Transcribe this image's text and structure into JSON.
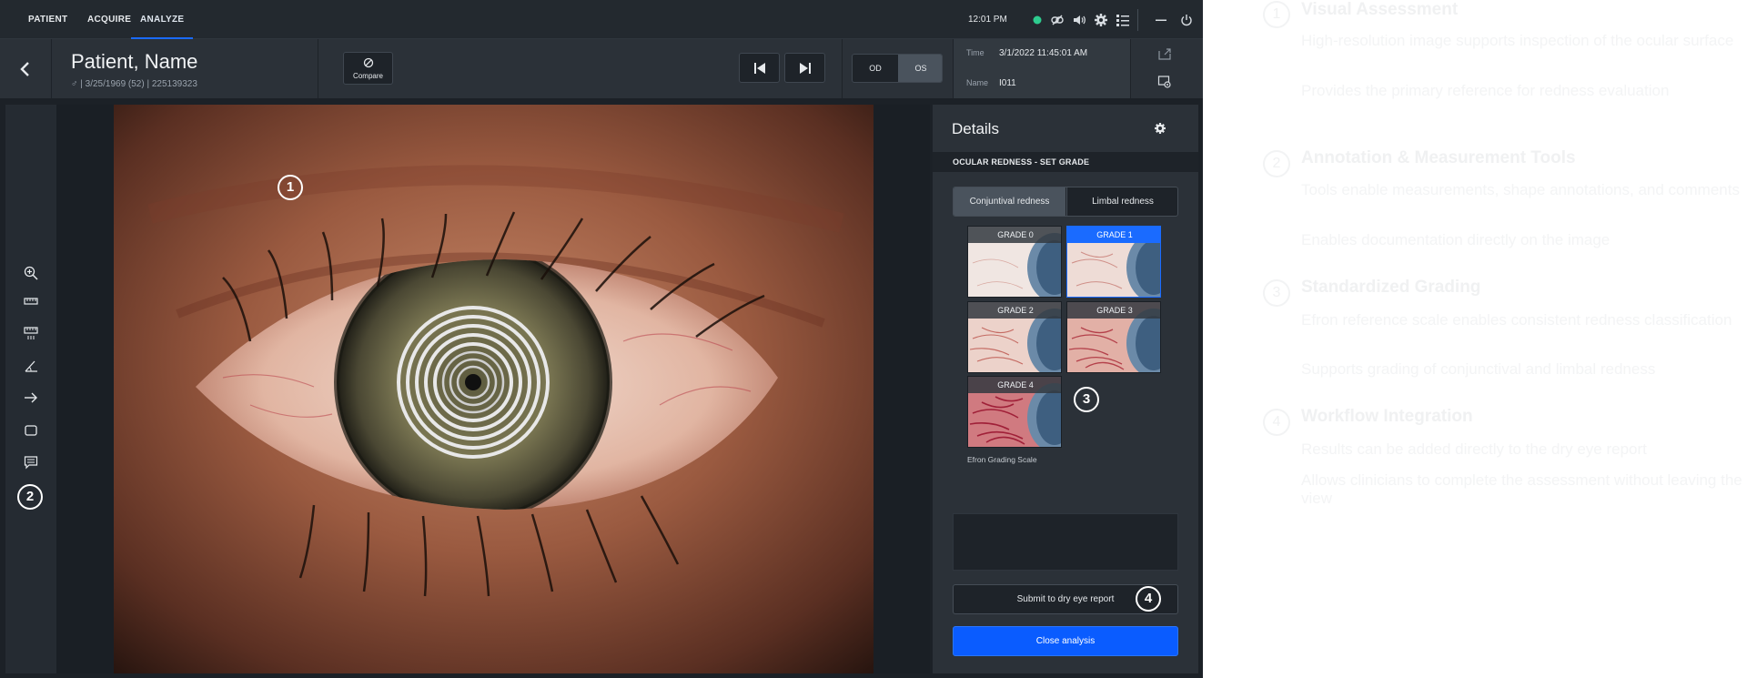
{
  "nav": {
    "tabs": [
      "PATIENT",
      "ACQUIRE",
      "ANALYZE"
    ],
    "active_tab": "ANALYZE",
    "clock": "12:01 PM",
    "status_color": "#2ecc8f"
  },
  "patient": {
    "name": "Patient, Name",
    "meta": "♂ | 3/25/1969 (52) | 225139323"
  },
  "toolbar": {
    "compare_label": "Compare"
  },
  "eye": {
    "od_label": "OD",
    "os_label": "OS",
    "selected": "OS"
  },
  "image_meta": {
    "time_label": "Time",
    "time_value": "3/1/2022 11:45:01 AM",
    "name_label": "Name",
    "name_value": "I011"
  },
  "details": {
    "title": "Details",
    "section": "OCULAR REDNESS - SET GRADE",
    "segments": [
      "Conjuntival redness",
      "Limbal redness"
    ],
    "selected_segment": "Conjuntival redness",
    "grades": [
      "GRADE 0",
      "GRADE 1",
      "GRADE 2",
      "GRADE 3",
      "GRADE 4"
    ],
    "selected_grade": "GRADE 1",
    "scale_label": "Efron Grading Scale",
    "submit_label": "Submit to dry eye report",
    "close_label": "Close analysis"
  },
  "tools": [
    "zoom-in-icon",
    "ruler-icon",
    "ruler-alt-icon",
    "angle-icon",
    "arrow-icon",
    "shape-icon",
    "comment-icon"
  ],
  "callouts": {
    "c1": "1",
    "c2": "2",
    "c3": "3",
    "c4": "4"
  },
  "colors": {
    "accent": "#1a6bff",
    "button_blue": "#0a5cff",
    "panel": "#2b3138"
  },
  "info": [
    {
      "num": "1",
      "title": "Visual Assessment",
      "lines": [
        "High-resolution image supports inspection of the ocular surface",
        "Provides the primary reference for redness evaluation"
      ]
    },
    {
      "num": "2",
      "title": "Annotation & Measurement Tools",
      "lines": [
        "Tools enable measurements, shape annotations, and comments",
        "Enables documentation directly on the image"
      ]
    },
    {
      "num": "3",
      "title": "Standardized Grading",
      "lines": [
        "Efron reference scale enables consistent redness classification",
        "Supports grading of conjunctival and limbal redness"
      ]
    },
    {
      "num": "4",
      "title": "Workflow Integration",
      "lines": [
        "Results can be added directly to the dry eye report",
        "Allows clinicians to complete the assessment without leaving the view"
      ]
    }
  ]
}
